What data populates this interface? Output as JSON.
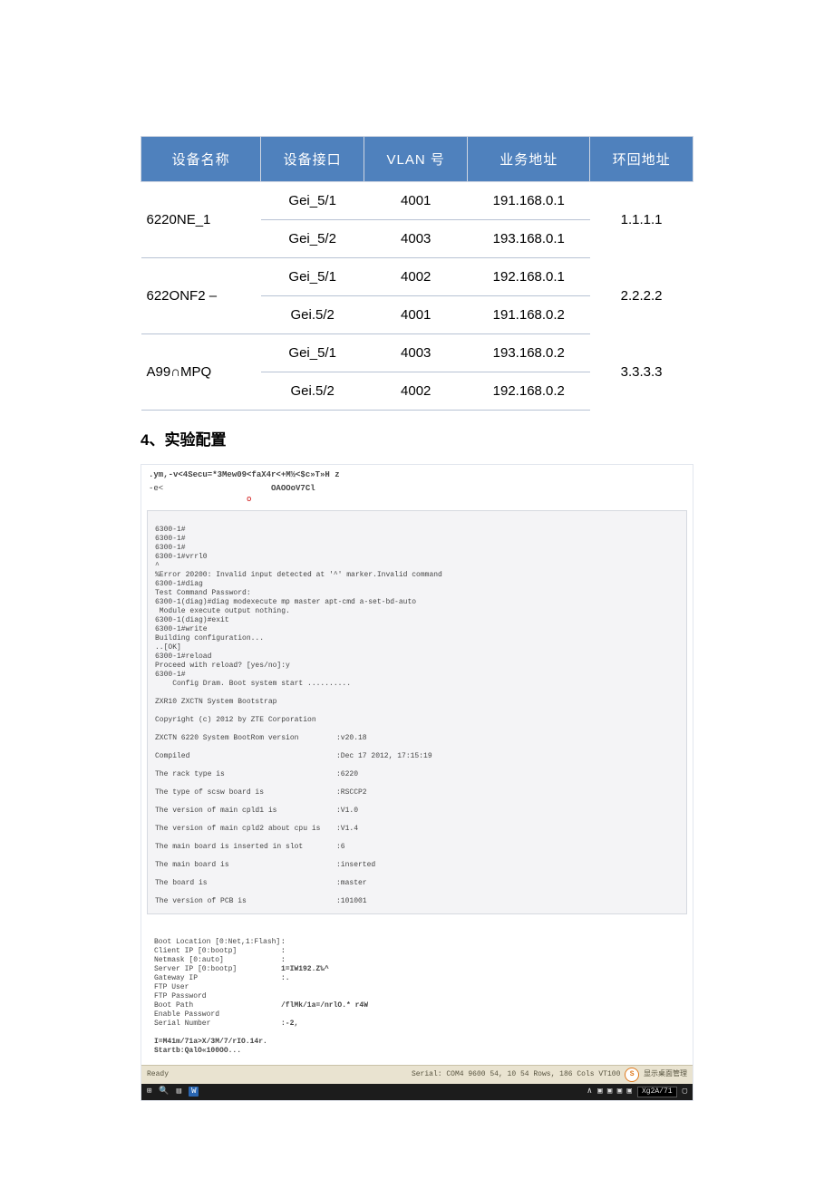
{
  "table": {
    "headers": [
      "设备名称",
      "设备接口",
      "VLAN 号",
      "业务地址",
      "环回地址"
    ],
    "groups": [
      {
        "device": "6220NE_1",
        "loop": "1.1.1.1",
        "rows": [
          {
            "ifc": "Gei_5/1",
            "vlan": "4001",
            "biz": "191.168.0.1"
          },
          {
            "ifc": "Gei_5/2",
            "vlan": "4003",
            "biz": "193.168.0.1"
          }
        ]
      },
      {
        "device": "622ONF2    –",
        "loop": "2.2.2.2",
        "rows": [
          {
            "ifc": "Gei_5/1",
            "vlan": "4002",
            "biz": "192.168.0.1"
          },
          {
            "ifc": "Gei.5/2",
            "vlan": "4001",
            "biz": "191.168.0.2"
          }
        ]
      },
      {
        "device": "A99∩MPQ",
        "loop": "3.3.3.3",
        "rows": [
          {
            "ifc": "Gei_5/1",
            "vlan": "4003",
            "biz": "193.168.0.2"
          },
          {
            "ifc": "Gei.5/2",
            "vlan": "4002",
            "biz": "192.168.0.2"
          }
        ]
      }
    ]
  },
  "section_title": "4、实验配置",
  "shot": {
    "hdr1": ".ym,-v<4Secu=*3Mew09<faX4r<+M½<$c»T»H        z",
    "hdr2_left": "-e<",
    "hdr2_right": "OAOOoV7Cl",
    "term_block": "6300-1#\n6300-1#\n6300-1#\n6300-1#vrrl0\n^\n%Error 20200: Invalid input detected at '^' marker.Invalid command\n6300-1#diag\nTest Command Password:\n6300-1(diag)#diag modexecute mp master apt-cmd a-set-bd-auto\n Module execute output nothing.\n6300-1(diag)#exit\n6300-1#write\nBuilding configuration...\n..[OK]\n6300-1#reload\nProceed with reload? [yes/no]:y\n6300-1#\n    Config Dram. Boot system start ..........",
    "term_rows": [
      {
        "l": "ZXR10 ZXCTN System Bootstrap",
        "v": ""
      },
      {
        "l": "Copyright (c) 2012 by ZTE Corporation",
        "v": ""
      },
      {
        "l": "ZXCTN 6220 System BootRom version",
        "v": ":v20.18"
      },
      {
        "l": "Compiled",
        "v": ":Dec 17 2012, 17:15:19"
      },
      {
        "l": "The rack type is",
        "v": ":6220"
      },
      {
        "l": "The type of scsw board is",
        "v": ":RSCCP2"
      },
      {
        "l": "The version of main cpld1 is",
        "v": ":V1.0"
      },
      {
        "l": "The version of main cpld2 about cpu is",
        "v": ":V1.4"
      },
      {
        "l": "The main board is inserted in slot",
        "v": ":6"
      },
      {
        "l": "The main board is",
        "v": ":inserted"
      },
      {
        "l": "The board is",
        "v": ":master"
      },
      {
        "l": "The version of PCB is",
        "v": ":101001"
      }
    ],
    "lower_rows": [
      {
        "l": "Boot Location [0:Net,1:Flash]",
        "v": ":"
      },
      {
        "l": "Client IP [0:bootp]",
        "v": ":"
      },
      {
        "l": "Netmask [0:auto]",
        "v": ":"
      },
      {
        "l": "Server IP [0:bootp]",
        "v": "1=IW192.Z‰^"
      },
      {
        "l": "Gateway IP",
        "v": ":."
      },
      {
        "l": "FTP User",
        "v": ""
      },
      {
        "l": "FTP Password",
        "v": ""
      },
      {
        "l": "Boot Path",
        "v": "/flMk/1a=/nrlO.* r4W"
      },
      {
        "l": "Enable Password",
        "v": ""
      },
      {
        "l": "Serial Number",
        "v": ":-2,"
      }
    ],
    "lower_bold": "I=M41m/71a>X/3M/7/rIO.14r.\nStartb:QalO«100OO...",
    "status_left": "Ready",
    "status_right": "Serial: COM4  9600    54,  10   54 Rows, 186 Cols  VT100",
    "status_cn": "显示桌面管理",
    "taskbar_tag": "Xg2A/71"
  }
}
